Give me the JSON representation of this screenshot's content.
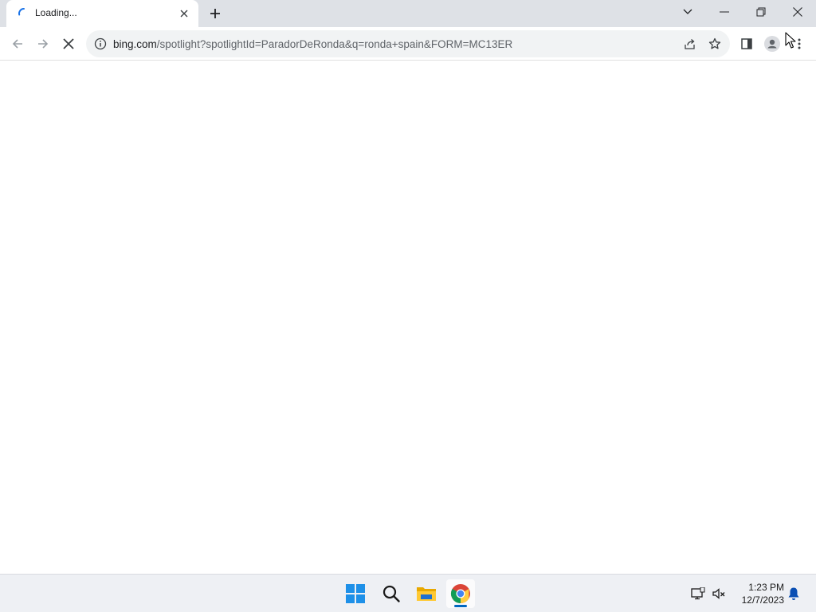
{
  "browser": {
    "tab": {
      "title": "Loading...",
      "icon": "loading-spinner-icon"
    },
    "new_tab_icon": "plus-icon",
    "window_controls": {
      "tab_search": "chevron-down-icon",
      "minimize": "minimize-icon",
      "restore": "restore-icon",
      "close": "close-icon"
    },
    "toolbar": {
      "back": "back-arrow-icon",
      "forward": "forward-arrow-icon",
      "stop": "stop-icon",
      "url_host": "bing.com",
      "url_rest": "/spotlight?spotlightId=ParadorDeRonda&q=ronda+spain&FORM=MC13ER",
      "share": "share-icon",
      "bookmark": "star-icon",
      "side_panel": "side-panel-icon",
      "profile": "profile-icon",
      "menu": "kebab-menu-icon"
    }
  },
  "taskbar": {
    "apps": [
      "windows-start-icon",
      "search-icon",
      "file-explorer-icon",
      "chrome-icon"
    ],
    "active_app": "chrome-icon",
    "tray": [
      "network-icon",
      "volume-muted-icon",
      "notification-bell-icon"
    ],
    "time": "1:23 PM",
    "date": "12/7/2023"
  },
  "colors": {
    "tabstrip_bg": "#dee1e6",
    "omnibox_bg": "#f1f3f4",
    "taskbar_bg": "#eef0f4",
    "accent": "#0067c0"
  }
}
